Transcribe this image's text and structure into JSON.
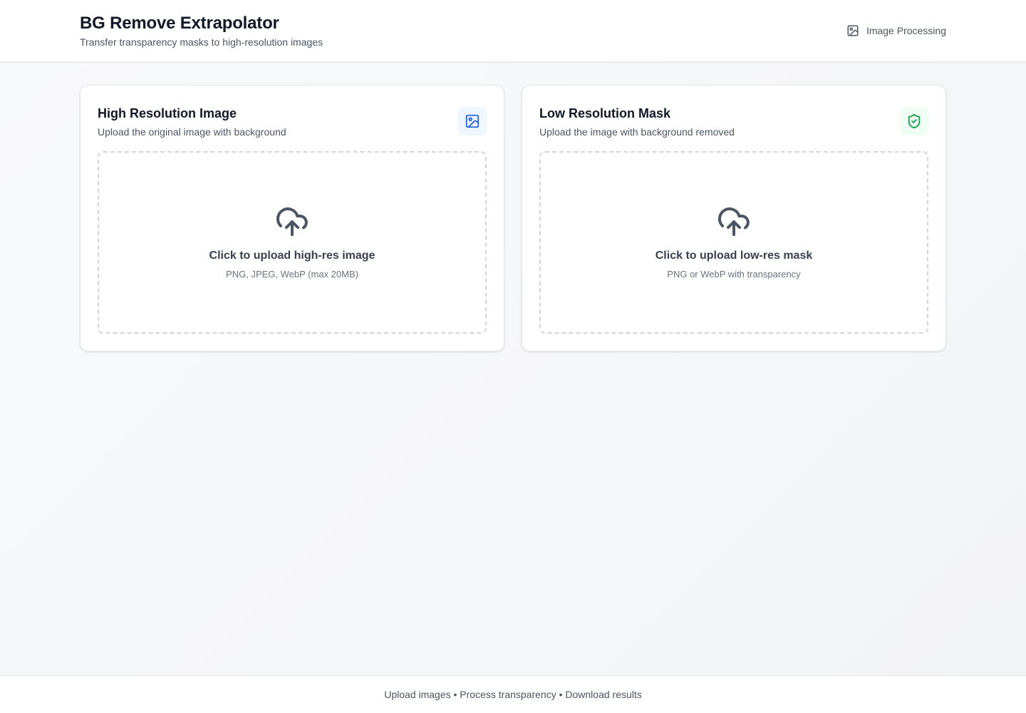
{
  "header": {
    "title": "BG Remove Extrapolator",
    "subtitle": "Transfer transparency masks to high-resolution images",
    "badge_label": "Image Processing",
    "badge_icon": "image-icon"
  },
  "cards": [
    {
      "title": "High Resolution Image",
      "description": "Upload the original image with background",
      "icon": "image-icon",
      "icon_color": "#2563eb",
      "dropzone": {
        "title": "Click to upload high-res image",
        "hint": "PNG, JPEG, WebP (max 20MB)",
        "icon": "cloud-upload-icon"
      }
    },
    {
      "title": "Low Resolution Mask",
      "description": "Upload the image with background removed",
      "icon": "shield-check-icon",
      "icon_color": "#16a34a",
      "dropzone": {
        "title": "Click to upload low-res mask",
        "hint": "PNG or WebP with transparency",
        "icon": "cloud-upload-icon"
      }
    }
  ],
  "footer": {
    "text": "Upload images • Process transparency • Download results"
  }
}
